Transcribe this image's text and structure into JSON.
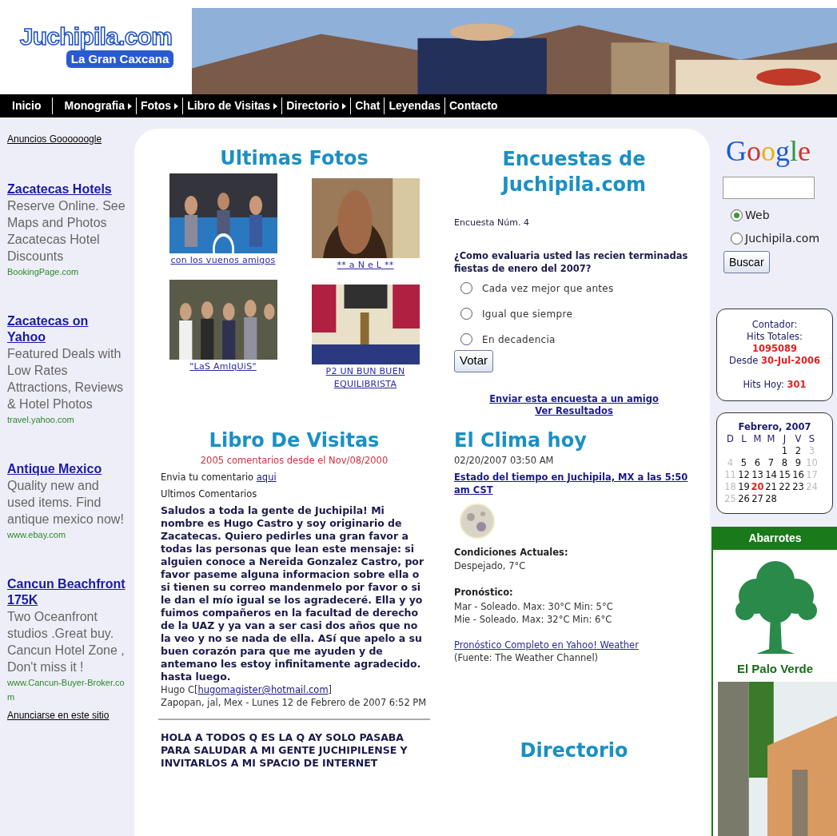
{
  "header": {
    "logo_title": "Juchipila.com",
    "logo_subtitle": "La Gran Caxcana"
  },
  "nav": [
    {
      "label": "Inicio",
      "has_submenu": false
    },
    {
      "label": "Monografia",
      "has_submenu": true
    },
    {
      "label": "Fotos",
      "has_submenu": true
    },
    {
      "label": "Libro de Visitas",
      "has_submenu": true
    },
    {
      "label": "Directorio",
      "has_submenu": true
    },
    {
      "label": "Chat",
      "has_submenu": false
    },
    {
      "label": "Leyendas",
      "has_submenu": false
    },
    {
      "label": "Contacto",
      "has_submenu": false
    }
  ],
  "ads": {
    "heading": "Anuncios Goooooogle",
    "items": [
      {
        "title": "Zacatecas Hotels",
        "body": "Reserve Online. See Maps and Photos Zacatecas Hotel Discounts",
        "url": "BookingPage.com"
      },
      {
        "title": "Zacatecas on Yahoo",
        "body": "Featured Deals with Low Rates Attractions, Reviews & Hotel Photos",
        "url": "travel.yahoo.com"
      },
      {
        "title": "Antique Mexico",
        "body": "Quality new and used items. Find antique mexico now!",
        "url": "www.ebay.com"
      },
      {
        "title": "Cancun Beachfront 175K",
        "body": "Two Oceanfront studios .Great buy. Cancun Hotel Zone , Don't miss it !",
        "url": "www.Cancun-Buyer-Broker.com"
      }
    ],
    "footer": "Anunciarse en este sitio"
  },
  "photos": {
    "title": "Ultimas Fotos",
    "items": [
      {
        "caption": "con los vuenos amigos",
        "kind": "picture"
      },
      {
        "caption": "** a N e L **",
        "kind": "picture"
      },
      {
        "caption": "\"LaS AmIqUiS\"",
        "kind": "picture"
      },
      {
        "caption": "P2 UN BUN BUEN EQUILIBRISTA",
        "kind": "picture"
      }
    ]
  },
  "poll": {
    "title": "Encuestas de Juchipila.com",
    "number": "Encuesta Núm. 4",
    "question": "¿Como evaluaria usted las recien terminadas fiestas de enero del 2007?",
    "options": [
      {
        "label": "Cada vez mejor que antes",
        "selected": false
      },
      {
        "label": "Igual que siempre",
        "selected": false
      },
      {
        "label": "En decadencia",
        "selected": false
      }
    ],
    "button": "Votar",
    "links": [
      "Enviar esta encuesta a un amigo",
      "Ver Resultados"
    ]
  },
  "guestbook": {
    "title": "Libro De Visitas",
    "count_line": "2005 comentarios desde el Nov/08/2000",
    "prompt": "Envia tu comentario",
    "prompt_link": "aqui",
    "subheading": "Ultimos Comentarios",
    "comments": [
      {
        "message": "Saludos a toda la gente de Juchipila! Mi nombre es Hugo Castro y soy originario de Zacatecas. Quiero pedirles una gran favor a todas las personas que lean este mensaje: si alguien conoce a Nereida Gonzalez Castro, por favor paseme alguna informacion sobre ella o si tienen su correo mandenmelo por favor o si le dan el mío igual se los agradeceré. Ella y yo fuimos compañeros en la facultad de derecho de la UAZ y ya van a ser casi dos años que no la veo y no se nada de ella. ASí que apelo a su buen corazón para que me ayuden y de antemano les estoy infinitamente agradecido. hasta luego.",
        "author": "Hugo C[",
        "email": "hugomagister@hotmail.com",
        "email_close": "]",
        "location_date": "Zapopan, jal, Mex - Lunes 12 de Febrero de 2007 6:52 PM"
      },
      {
        "message": "HOLA A TODOS Q ES LA Q AY SOLO PASABA PARA SALUDAR A MI GENTE JUCHIPILENSE Y INVITARLOS A MI SPACIO DE INTERNET"
      }
    ]
  },
  "weather": {
    "title": "El Clima hoy",
    "timestamp": "02/20/2007 03:50 AM",
    "link": "Estado del tiempo en Juchipila, MX a las 5:50 am CST",
    "conditions_label": "Condiciones Actuales:",
    "conditions": "Despejado, 7°C",
    "forecast_label": "Pronóstico:",
    "forecast": [
      "Mar - Soleado. Max: 30°C Min: 5°C",
      "Mie - Soleado. Max: 32°C Min: 6°C"
    ],
    "full_link": "Pronóstico Completo en Yahoo! Weather",
    "source": "(Fuente: The Weather Channel)"
  },
  "directory": {
    "title": "Directorio"
  },
  "google": {
    "logo": "Google",
    "options": [
      {
        "label": "Web",
        "selected": true
      },
      {
        "label": "Juchipila.com",
        "selected": false
      }
    ],
    "button": "Buscar"
  },
  "counter": {
    "label": "Contador:",
    "total_label": "Hits Totales:",
    "total": "1095089",
    "since_label": "Desde",
    "since": "30-Jul-2006",
    "today_label": "Hits Hoy:",
    "today": "301"
  },
  "calendar": {
    "title": "Febrero, 2007",
    "weekdays": [
      "D",
      "L",
      "M",
      "M",
      "J",
      "V",
      "S"
    ],
    "weeks": [
      [
        {
          "day": "1",
          "kind": "weekday"
        },
        {
          "day": "2",
          "kind": "weekday"
        },
        {
          "day": "3",
          "kind": "weekend"
        }
      ],
      [
        {
          "day": "4",
          "kind": "weekend"
        },
        {
          "day": "5",
          "kind": "weekday"
        },
        {
          "day": "6",
          "kind": "weekday"
        },
        {
          "day": "7",
          "kind": "weekday"
        },
        {
          "day": "8",
          "kind": "weekday"
        },
        {
          "day": "9",
          "kind": "weekday"
        },
        {
          "day": "10",
          "kind": "weekend"
        }
      ],
      [
        {
          "day": "11",
          "kind": "weekend"
        },
        {
          "day": "12",
          "kind": "weekday"
        },
        {
          "day": "13",
          "kind": "weekday"
        },
        {
          "day": "14",
          "kind": "weekday"
        },
        {
          "day": "15",
          "kind": "weekday"
        },
        {
          "day": "16",
          "kind": "weekday"
        },
        {
          "day": "17",
          "kind": "weekend"
        }
      ],
      [
        {
          "day": "18",
          "kind": "weekend"
        },
        {
          "day": "19",
          "kind": "weekday"
        },
        {
          "day": "20",
          "kind": "today"
        },
        {
          "day": "21",
          "kind": "weekday"
        },
        {
          "day": "22",
          "kind": "weekday"
        },
        {
          "day": "23",
          "kind": "weekday"
        },
        {
          "day": "24",
          "kind": "weekend"
        }
      ],
      [
        {
          "day": "25",
          "kind": "weekend"
        },
        {
          "day": "26",
          "kind": "weekday"
        },
        {
          "day": "27",
          "kind": "weekday"
        },
        {
          "day": "28",
          "kind": "weekday"
        }
      ]
    ]
  },
  "sponsor": {
    "heading": "Abarrotes",
    "name": "El Palo Verde"
  }
}
